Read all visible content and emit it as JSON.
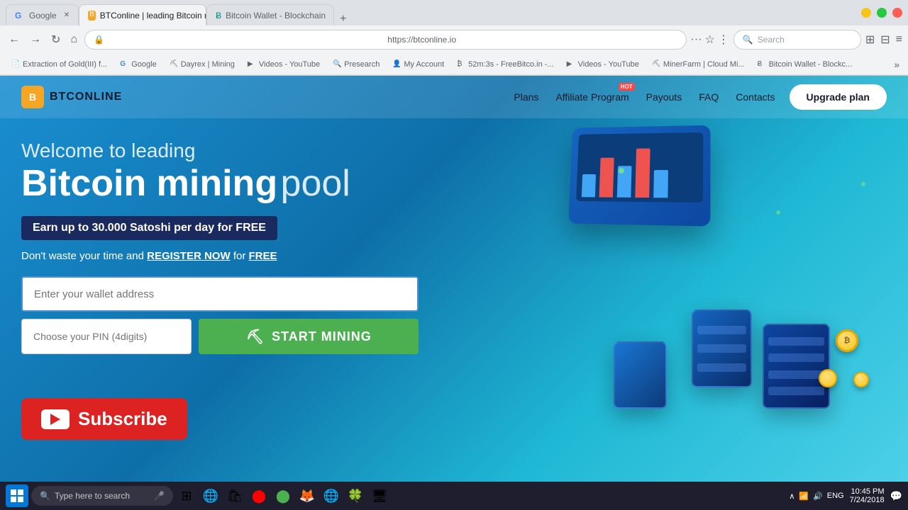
{
  "browser": {
    "tabs": [
      {
        "id": "tab-google",
        "label": "Google",
        "favicon": "G",
        "active": false,
        "favicon_color": "#4285f4"
      },
      {
        "id": "tab-btconline",
        "label": "BTConline | leading Bitcoin mi...",
        "favicon": "B",
        "active": true,
        "favicon_color": "#f5a623"
      },
      {
        "id": "tab-blockchain",
        "label": "Bitcoin Wallet - Blockchain",
        "favicon": "Ƀ",
        "active": false,
        "favicon_color": "#00897b"
      }
    ],
    "address": "https://btconline.io",
    "search_placeholder": "Search",
    "bookmarks": [
      {
        "label": "Extraction of Gold(III) f...",
        "icon": "📄"
      },
      {
        "label": "Google",
        "icon": "G"
      },
      {
        "label": "Dayrex | Mining",
        "icon": "⛏"
      },
      {
        "label": "Videos - YouTube",
        "icon": "▶"
      },
      {
        "label": "Presearch",
        "icon": "🔍"
      },
      {
        "label": "My Account",
        "icon": "👤"
      },
      {
        "label": "52m:3s - FreeBitco.in -...",
        "icon": "₿"
      },
      {
        "label": "Videos - YouTube",
        "icon": "▶"
      },
      {
        "label": "MinerFarm | Cloud Mi...",
        "icon": "⛏"
      },
      {
        "label": "Bitcoin Wallet - Blockc...",
        "icon": "Ƀ"
      }
    ]
  },
  "site": {
    "logo_icon": "B",
    "logo_text": "BTCONLINE",
    "nav": {
      "plans": "Plans",
      "affiliate": "Affiliate Program",
      "payouts": "Payouts",
      "payouts_hot": true,
      "faq": "FAQ",
      "contacts": "Contacts",
      "upgrade": "Upgrade plan"
    },
    "hero": {
      "title_top": "Welcome to leading",
      "title_bold": "Bitcoin mining",
      "title_light": "pool",
      "badge": "Earn up to 30.000 Satoshi per day for FREE",
      "cta_text": "Don't waste your time and",
      "cta_link": "REGISTER NOW",
      "cta_suffix": "for",
      "cta_free": "FREE"
    },
    "form": {
      "wallet_placeholder": "Enter your wallet address",
      "pin_placeholder": "Choose your PIN (4digits)",
      "start_btn": "START MINING"
    }
  },
  "subscribe": {
    "label": "Subscribe"
  },
  "chart_bars": [
    {
      "height": 30,
      "color": "#42a5f5"
    },
    {
      "height": 50,
      "color": "#ef5350"
    },
    {
      "height": 40,
      "color": "#42a5f5"
    },
    {
      "height": 60,
      "color": "#ef5350"
    },
    {
      "height": 35,
      "color": "#42a5f5"
    }
  ],
  "taskbar": {
    "search_placeholder": "Type here to search",
    "time": "10:45 PM",
    "date": "7/24/2018",
    "lang": "ENG",
    "icons": [
      "🗔",
      "📁",
      "🌐",
      "⊕",
      "🔴",
      "🟢",
      "🦊",
      "🌐",
      "🍀",
      "🖥"
    ]
  }
}
